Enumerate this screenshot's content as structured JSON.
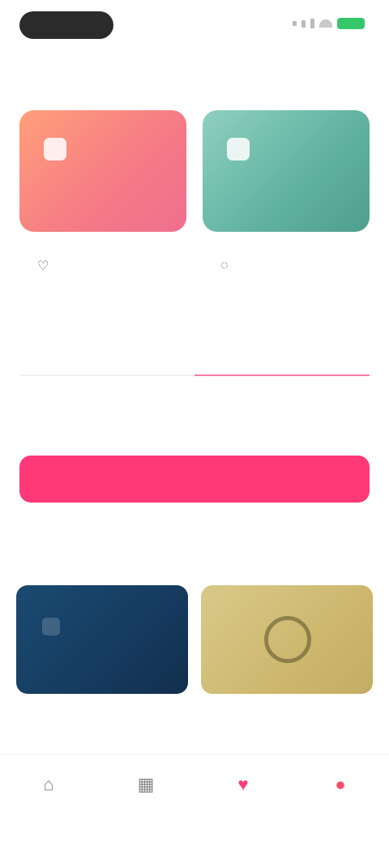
{
  "status_bar": {
    "time": "",
    "battery_color": "#35c76a"
  },
  "header": {
    "title": "",
    "link": ""
  },
  "tiles": [
    {
      "label": "",
      "icon": "app-icon",
      "color_from": "#ff9f7a",
      "color_to": "#ef6f8f"
    },
    {
      "label": "",
      "icon": "app-icon",
      "color_from": "#8fd0c0",
      "color_to": "#4e9f8f"
    }
  ],
  "meta": [
    {
      "icon": "heart-icon",
      "text": ""
    },
    {
      "icon": "comment-icon",
      "text": ""
    }
  ],
  "toggle": {
    "tabs": [
      "",
      ""
    ],
    "active_index": 1,
    "accent": "#ff3d78"
  },
  "note": "",
  "primary_button": {
    "label": "",
    "color": "#ff3878"
  },
  "section": {
    "title": "",
    "link": ""
  },
  "cards": [
    {
      "caption": "",
      "color": "#163c60"
    },
    {
      "caption": "",
      "color": "#cdb86e"
    }
  ],
  "tabbar": {
    "items": [
      {
        "icon": "home-icon",
        "label": ""
      },
      {
        "icon": "grid-icon",
        "label": ""
      },
      {
        "icon": "heart-icon",
        "label": ""
      },
      {
        "icon": "profile-icon",
        "label": ""
      }
    ],
    "active_index": 2
  }
}
